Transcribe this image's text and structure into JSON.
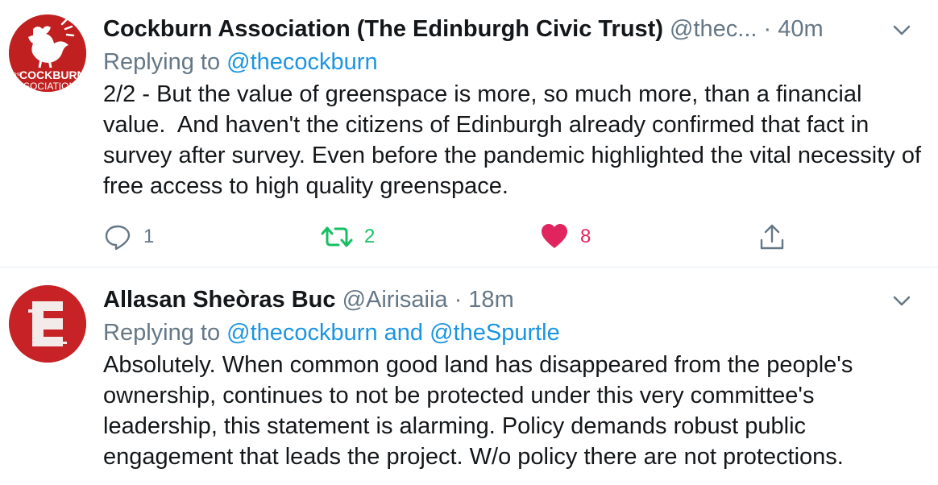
{
  "tweets": [
    {
      "author": "Cockburn Association (The Edinburgh Civic Trust)",
      "handle": "@thec...",
      "time": "· 40m",
      "replying_prefix": "Replying to ",
      "replying_to": "@thecockburn",
      "replying_and": "",
      "replying_to_2": "",
      "text": "2/2 - But the value of greenspace is more, so much more, than a financial value.  And haven't the citizens of Edinburgh already confirmed that fact in survey after survey. Even before the pandemic highlighted the vital necessity of free access to high quality greenspace.",
      "avatar_text_1": "THE",
      "avatar_text_2": "COCKBURN",
      "avatar_text_3": "ASSOCIATION",
      "counts": {
        "replies": "1",
        "retweets": "2",
        "likes": "8"
      },
      "liked": true,
      "colors": {
        "retweet": "#17bf63",
        "like": "#e0245e"
      }
    },
    {
      "author": "Allasan Sheòras Buc",
      "handle": "@Airisaiia",
      "time": "· 18m",
      "replying_prefix": "Replying to ",
      "replying_to": "@thecockburn",
      "replying_and": " and ",
      "replying_to_2": "@theSpurtle",
      "text": "Absolutely. When common good land has disappeared from the people's ownership, continues to not be protected under this very committee's leadership, this statement is alarming. Policy demands robust public engagement that leads the project. W/o policy there are not protections.",
      "avatar_text_1": "E"
    }
  ],
  "icons": {
    "reply": "reply-icon",
    "retweet": "retweet-icon",
    "like": "heart-icon",
    "share": "share-icon",
    "menu": "chevron-down-icon"
  },
  "colors": {
    "link": "#1b95e0",
    "muted": "#657786",
    "text": "#14171a"
  }
}
